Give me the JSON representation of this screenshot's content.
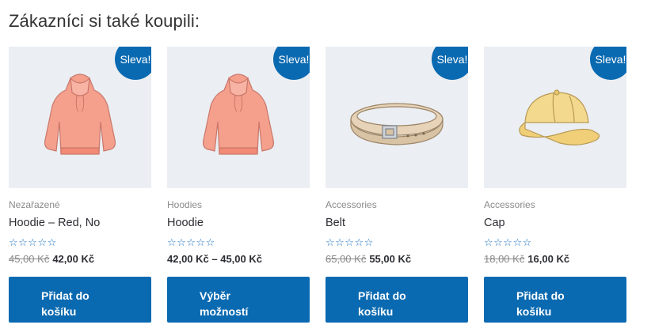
{
  "section": {
    "heading": "Zákazníci si také koupili:"
  },
  "products": [
    {
      "image_icon": "hoodie-icon",
      "badge": "Sleva!",
      "category": "Nezařazené",
      "title": "Hoodie – Red, No",
      "rating_stars": "☆☆☆☆☆",
      "price_old": "45,00 Kč",
      "price": "42,00 Kč",
      "button": "Přidat do košíku"
    },
    {
      "image_icon": "hoodie-icon",
      "badge": "Sleva!",
      "category": "Hoodies",
      "title": "Hoodie",
      "rating_stars": "☆☆☆☆☆",
      "price_old": "",
      "price": "42,00 Kč – 45,00 Kč",
      "button": "Výběr možností"
    },
    {
      "image_icon": "belt-icon",
      "badge": "Sleva!",
      "category": "Accessories",
      "title": "Belt",
      "rating_stars": "☆☆☆☆☆",
      "price_old": "65,00 Kč",
      "price": "55,00 Kč",
      "button": "Přidat do košíku"
    },
    {
      "image_icon": "cap-icon",
      "badge": "Sleva!",
      "category": "Accessories",
      "title": "Cap",
      "rating_stars": "☆☆☆☆☆",
      "price_old": "18,00 Kč",
      "price": "16,00 Kč",
      "button": "Přidat do košíku"
    }
  ],
  "colors": {
    "accent": "#0a6ab1",
    "image_bg": "#ebeef2",
    "hoodie": "#f4a08d",
    "belt": "#d9c3a5",
    "cap": "#f3d98e"
  }
}
